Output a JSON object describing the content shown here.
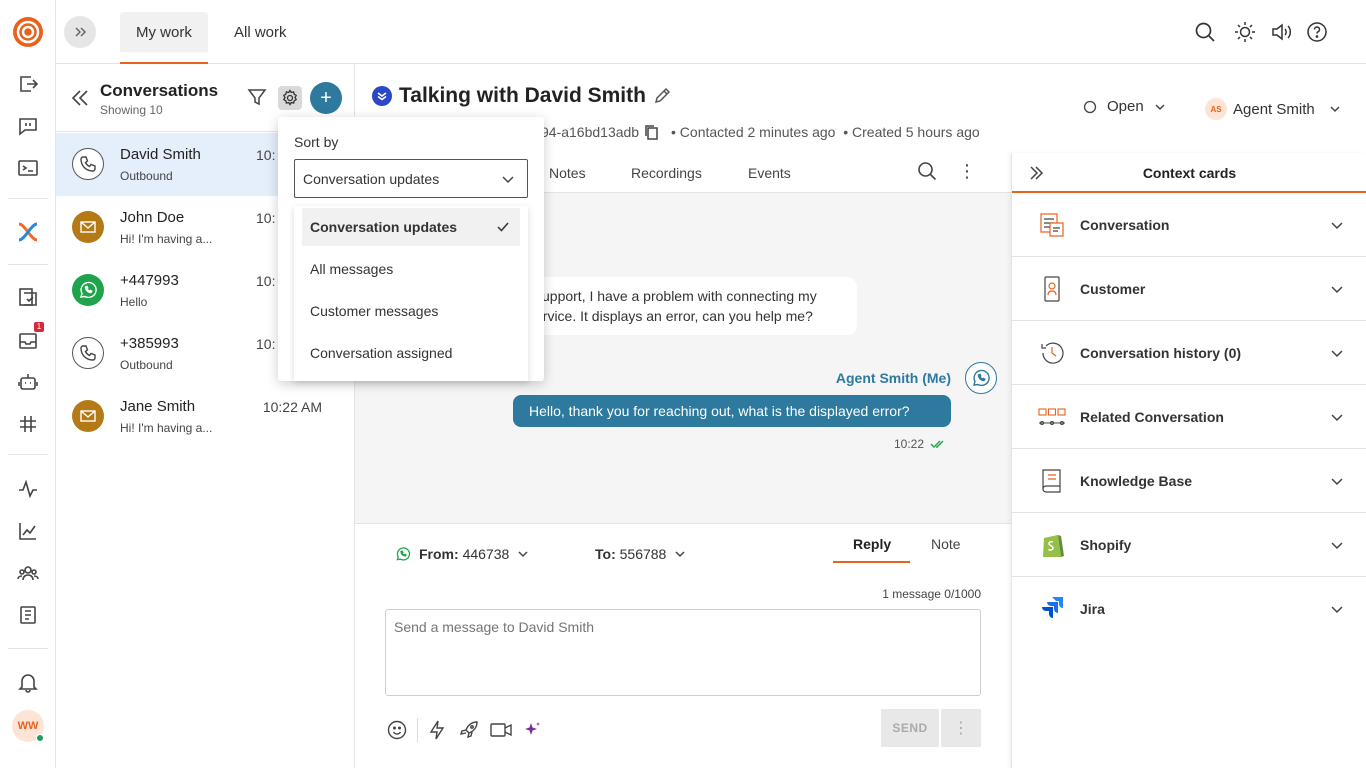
{
  "topbar": {
    "tabs": [
      {
        "label": "My work"
      },
      {
        "label": "All work"
      }
    ]
  },
  "rail": {
    "notification_count": "1",
    "avatar_initials": "WW"
  },
  "conversations": {
    "title": "Conversations",
    "subtitle": "Showing 10",
    "items": [
      {
        "name": "David Smith",
        "preview": "Outbound",
        "time": "10:",
        "type": "phone"
      },
      {
        "name": "John Doe",
        "preview": "Hi! I'm having a...",
        "time": "10:",
        "type": "mail"
      },
      {
        "name": "+447993",
        "preview": "Hello",
        "time": "10:",
        "type": "whatsapp"
      },
      {
        "name": "+385993",
        "preview": "Outbound",
        "time": "10:",
        "type": "phone"
      },
      {
        "name": "Jane Smith",
        "preview": "Hi! I'm having a...",
        "time": "10:22 AM",
        "type": "mail"
      }
    ]
  },
  "sort_menu": {
    "label": "Sort by",
    "selected": "Conversation updates",
    "options": [
      {
        "label": "Conversation updates"
      },
      {
        "label": "All messages"
      },
      {
        "label": "Customer messages"
      },
      {
        "label": "Conversation assigned"
      }
    ]
  },
  "main": {
    "title": "Talking with David Smith",
    "id_fragment": "94-a16bd13adb",
    "contacted": "Contacted 2 minutes ago",
    "created": "Created 5 hours ago",
    "status": "Open",
    "agent_initials": "AS",
    "agent": "Agent Smith",
    "tabs": [
      {
        "label": "Notes"
      },
      {
        "label": "Recordings"
      },
      {
        "label": "Events"
      }
    ],
    "incoming_message": "support, I have a problem with connecting my ervice. It displays an error, can you help me?",
    "agent_label": "Agent Smith (Me)",
    "outgoing_message": "Hello, thank you for reaching out, what is the displayed error?",
    "outgoing_time": "10:22"
  },
  "composer": {
    "from_label": "From:",
    "from_value": "446738",
    "to_label": "To:",
    "to_value": "556788",
    "tab_reply": "Reply",
    "tab_note": "Note",
    "count": "1 message 0/1000",
    "placeholder": "Send a message to David Smith",
    "send_label": "SEND"
  },
  "context": {
    "title": "Context cards",
    "cards": [
      {
        "label": "Conversation"
      },
      {
        "label": "Customer"
      },
      {
        "label": "Conversation history (0)"
      },
      {
        "label": "Related Conversation"
      },
      {
        "label": "Knowledge Base"
      },
      {
        "label": "Shopify"
      },
      {
        "label": "Jira"
      }
    ]
  },
  "colors": {
    "accent": "#e8621d",
    "primary": "#2d7a9e",
    "selected_row": "#e5eefb",
    "whatsapp": "#1fa44b"
  }
}
